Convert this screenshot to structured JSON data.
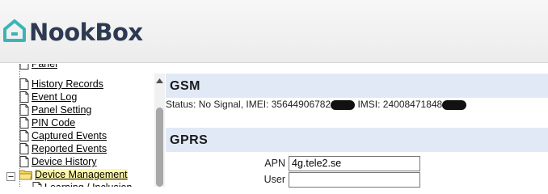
{
  "brand": {
    "name": "NookBox"
  },
  "sidebar": {
    "items": [
      {
        "label": "Panel",
        "icon": "document-icon"
      },
      {
        "label": "History Records",
        "icon": "document-icon"
      },
      {
        "label": "Event Log",
        "icon": "document-icon"
      },
      {
        "label": "Panel Setting",
        "icon": "document-icon"
      },
      {
        "label": "PIN Code",
        "icon": "document-icon"
      },
      {
        "label": "Captured Events",
        "icon": "document-icon"
      },
      {
        "label": "Reported Events",
        "icon": "document-icon"
      },
      {
        "label": "Device History",
        "icon": "document-icon"
      },
      {
        "label": "Device Management",
        "icon": "folder-open-icon"
      },
      {
        "label": "Learning / Inclusion",
        "icon": "document-icon"
      }
    ]
  },
  "gsm": {
    "title": "GSM",
    "status_prefix": "Status: No Signal, IMEI: 35644906782",
    "imsi_prefix": " IMSI: 24008471848"
  },
  "gprs": {
    "title": "GPRS",
    "apn_label": "APN",
    "apn_value": "4g.tele2.se",
    "user_label": "User",
    "user_value": ""
  },
  "colors": {
    "section_bg": "#e1e9f6",
    "logo_accent": "#3bb4b8",
    "logo_text": "#2e3a52"
  }
}
